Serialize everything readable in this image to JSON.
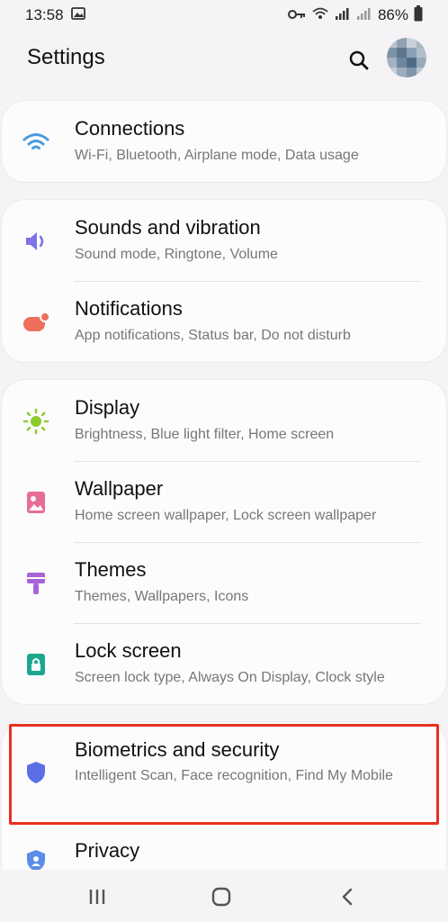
{
  "status": {
    "time": "13:58",
    "battery": "86%"
  },
  "header": {
    "title": "Settings"
  },
  "groups": [
    {
      "items": [
        {
          "label": "Connections",
          "sub": "Wi-Fi, Bluetooth, Airplane mode, Data usage",
          "icon": "wifi-icon",
          "color": "#4a9be0"
        }
      ]
    },
    {
      "items": [
        {
          "label": "Sounds and vibration",
          "sub": "Sound mode, Ringtone, Volume",
          "icon": "volume-icon",
          "color": "#7d72e8"
        },
        {
          "label": "Notifications",
          "sub": "App notifications, Status bar, Do not disturb",
          "icon": "notification-icon",
          "color": "#ee6f5b"
        }
      ]
    },
    {
      "items": [
        {
          "label": "Display",
          "sub": "Brightness, Blue light filter, Home screen",
          "icon": "sun-icon",
          "color": "#8ccc2c"
        },
        {
          "label": "Wallpaper",
          "sub": "Home screen wallpaper, Lock screen wallpaper",
          "icon": "wallpaper-icon",
          "color": "#e86d96"
        },
        {
          "label": "Themes",
          "sub": "Themes, Wallpapers, Icons",
          "icon": "brush-icon",
          "color": "#a764d6"
        },
        {
          "label": "Lock screen",
          "sub": "Screen lock type, Always On Display, Clock style",
          "icon": "lock-icon",
          "color": "#1aa88f"
        }
      ]
    },
    {
      "items": [
        {
          "label": "Biometrics and security",
          "sub": "Intelligent Scan, Face recognition, Find My Mobile",
          "icon": "shield-icon",
          "color": "#5b6ee6"
        },
        {
          "label": "Privacy",
          "sub": "",
          "icon": "privacy-icon",
          "color": "#5a8de8"
        }
      ]
    }
  ],
  "highlight_color": "#e8301f"
}
